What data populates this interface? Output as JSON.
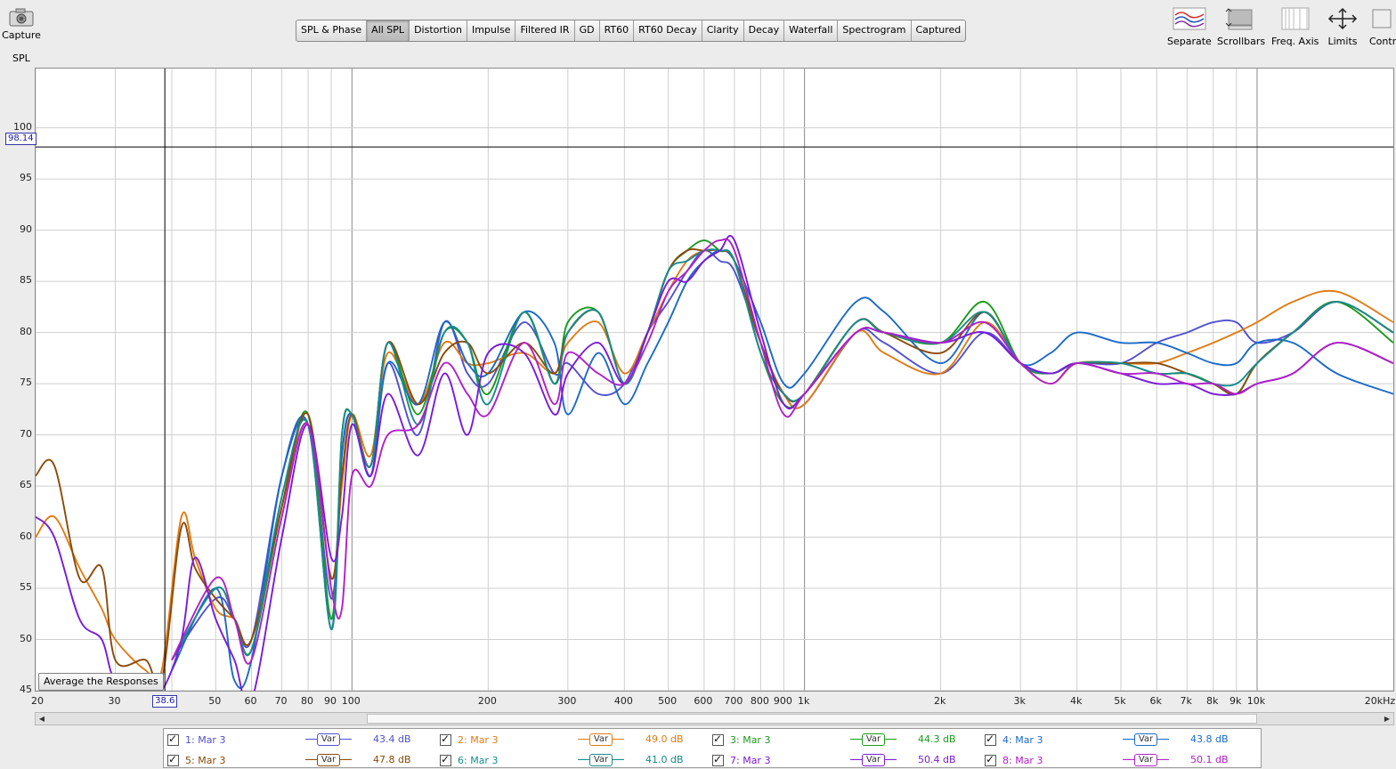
{
  "toolbar": {
    "capture_label": "Capture",
    "tabs": [
      "SPL & Phase",
      "All SPL",
      "Distortion",
      "Impulse",
      "Filtered IR",
      "GD",
      "RT60",
      "RT60 Decay",
      "Clarity",
      "Decay",
      "Waterfall",
      "Spectrogram",
      "Captured"
    ],
    "active_tab": "All SPL",
    "right_tools": [
      {
        "label": "Separate",
        "icon": "separate-icon"
      },
      {
        "label": "Scrollbars",
        "icon": "scrollbars-icon"
      },
      {
        "label": "Freq. Axis",
        "icon": "freq-axis-icon"
      },
      {
        "label": "Limits",
        "icon": "limits-icon"
      },
      {
        "label": "Controls",
        "icon": "controls-icon"
      }
    ]
  },
  "plot": {
    "y_title": "SPL",
    "cursor_y_value": "98.14",
    "cursor_x_value": "38.6",
    "average_button": "Average the Responses"
  },
  "chart_data": {
    "type": "line",
    "ylabel": "SPL",
    "ylim": [
      45,
      105.8
    ],
    "xlim": [
      20,
      20000
    ],
    "x_scale": "log",
    "y_ticks": [
      "100",
      "95",
      "90",
      "85",
      "80",
      "75",
      "70",
      "65",
      "60",
      "55",
      "50",
      "45"
    ],
    "x_ticks": [
      "20",
      "30",
      "38.6",
      "50",
      "60",
      "70",
      "80",
      "90",
      "100",
      "200",
      "300",
      "400",
      "500",
      "600",
      "700",
      "800",
      "900",
      "1k",
      "2k",
      "3k",
      "4k",
      "5k",
      "6k",
      "7k",
      "8k",
      "9k",
      "10k",
      "20kHz"
    ],
    "grid": true,
    "cursor": {
      "x": 38.6,
      "y": 98.14
    },
    "series": [
      {
        "name": "1: Mar 3",
        "color": "#5050d0",
        "x": [
          40,
          50,
          55,
          60,
          70,
          80,
          90,
          95,
          100,
          110,
          120,
          140,
          160,
          180,
          200,
          240,
          280,
          300,
          350,
          400,
          450,
          500,
          550,
          600,
          650,
          700,
          800,
          900,
          1000,
          1300,
          1500,
          2000,
          2500,
          3000,
          3500,
          4000,
          5000,
          6000,
          7000,
          8000,
          9000,
          10000,
          12000,
          15000,
          20000
        ],
        "y": [
          48,
          54,
          52,
          50,
          66,
          71,
          54,
          68,
          72,
          66,
          77,
          70,
          81,
          76,
          75,
          81,
          76,
          77,
          74,
          75,
          80,
          83,
          86,
          88,
          87,
          86,
          79,
          74,
          73,
          80,
          79,
          76,
          80,
          77,
          76,
          77,
          77,
          79,
          80,
          81,
          81,
          79,
          80,
          83,
          80
        ]
      },
      {
        "name": "2: Mar 3",
        "color": "#e07b12",
        "x": [
          20,
          22,
          25,
          28,
          30,
          35,
          38,
          42,
          45,
          50,
          55,
          60,
          70,
          80,
          90,
          95,
          100,
          110,
          120,
          140,
          160,
          180,
          200,
          240,
          280,
          300,
          350,
          400,
          450,
          500,
          550,
          600,
          650,
          700,
          800,
          900,
          1000,
          1300,
          1500,
          2000,
          2500,
          3000,
          3500,
          4000,
          5000,
          6000,
          7000,
          8000,
          9000,
          10000,
          12000,
          15000,
          20000
        ],
        "y": [
          60,
          62,
          57,
          53,
          50,
          47,
          47,
          62,
          58,
          53,
          52,
          50,
          63,
          71,
          56,
          65,
          72,
          68,
          78,
          73,
          79,
          77,
          77,
          78,
          76,
          79,
          81,
          76,
          80,
          84,
          87,
          88,
          88,
          87,
          79,
          74,
          73,
          80,
          78,
          76,
          81,
          77,
          75,
          77,
          77,
          77,
          78,
          79,
          80,
          81,
          83,
          84,
          81
        ]
      },
      {
        "name": "3: Mar 3",
        "color": "#1a9a1a",
        "x": [
          40,
          50,
          55,
          60,
          70,
          80,
          90,
          95,
          100,
          110,
          120,
          140,
          160,
          180,
          200,
          240,
          280,
          300,
          350,
          400,
          450,
          500,
          550,
          600,
          650,
          700,
          800,
          900,
          1000,
          1300,
          1500,
          2000,
          2500,
          3000,
          3500,
          4000,
          5000,
          6000,
          7000,
          8000,
          9000,
          10000,
          12000,
          15000,
          20000
        ],
        "y": [
          48,
          55,
          52,
          49,
          63,
          72,
          52,
          70,
          72,
          67,
          79,
          72,
          80,
          79,
          74,
          82,
          75,
          81,
          82,
          75,
          80,
          86,
          88,
          89,
          88,
          87,
          78,
          73,
          74,
          81,
          80,
          79,
          83,
          77,
          76,
          77,
          77,
          76,
          76,
          75,
          74,
          77,
          80,
          83,
          79
        ]
      },
      {
        "name": "4: Mar 3",
        "color": "#1a6ac8",
        "x": [
          40,
          50,
          55,
          60,
          70,
          80,
          90,
          95,
          100,
          110,
          120,
          140,
          160,
          180,
          200,
          240,
          280,
          300,
          350,
          400,
          450,
          500,
          550,
          600,
          650,
          700,
          800,
          900,
          1000,
          1300,
          1500,
          2000,
          2500,
          3000,
          3500,
          4000,
          5000,
          6000,
          7000,
          8000,
          9000,
          10000,
          12000,
          15000,
          20000
        ],
        "y": [
          47,
          55,
          46,
          48,
          66,
          71,
          51,
          68,
          72,
          66,
          77,
          73,
          81,
          77,
          76,
          82,
          79,
          72,
          78,
          73,
          77,
          81,
          85,
          87,
          88,
          87,
          81,
          75,
          76,
          83,
          82,
          77,
          82,
          77,
          78,
          80,
          79,
          79,
          78,
          77,
          77,
          79,
          79,
          76,
          74
        ]
      },
      {
        "name": "5: Mar 3",
        "color": "#8b4a0a",
        "x": [
          20,
          22,
          25,
          28,
          30,
          35,
          38,
          42,
          45,
          50,
          55,
          60,
          70,
          80,
          90,
          95,
          100,
          110,
          120,
          140,
          160,
          180,
          200,
          240,
          280,
          300,
          350,
          400,
          450,
          500,
          550,
          600,
          650,
          700,
          800,
          900,
          1000,
          1300,
          1500,
          2000,
          2500,
          3000,
          3500,
          4000,
          5000,
          6000,
          7000,
          8000,
          9000,
          10000,
          12000,
          15000,
          20000
        ],
        "y": [
          66,
          67,
          56,
          57,
          48,
          48,
          46,
          61,
          57,
          54,
          52,
          50,
          63,
          72,
          56,
          66,
          72,
          67,
          79,
          73,
          78,
          79,
          76,
          79,
          76,
          80,
          82,
          75,
          80,
          86,
          88,
          88,
          88,
          87,
          79,
          74,
          74,
          81,
          80,
          78,
          82,
          77,
          76,
          77,
          77,
          77,
          76,
          75,
          74,
          77,
          80,
          83,
          80
        ]
      },
      {
        "name": "6: Mar 3",
        "color": "#168c8c",
        "x": [
          40,
          50,
          55,
          60,
          70,
          80,
          90,
          95,
          100,
          110,
          120,
          140,
          160,
          180,
          200,
          240,
          280,
          300,
          350,
          400,
          450,
          500,
          550,
          600,
          650,
          700,
          800,
          900,
          1000,
          1300,
          1500,
          2000,
          2500,
          3000,
          3500,
          4000,
          5000,
          6000,
          7000,
          8000,
          9000,
          10000,
          12000,
          15000,
          20000
        ],
        "y": [
          48,
          55,
          52,
          49,
          64,
          71,
          51,
          70,
          72,
          67,
          79,
          71,
          80,
          79,
          73,
          82,
          75,
          80,
          82,
          75,
          80,
          86,
          87,
          88,
          88,
          87,
          78,
          74,
          74,
          81,
          80,
          79,
          82,
          77,
          76,
          77,
          77,
          76,
          76,
          75,
          75,
          77,
          80,
          83,
          80
        ]
      },
      {
        "name": "7: Mar 3",
        "color": "#7a1ad8",
        "x": [
          20,
          22,
          25,
          28,
          30,
          35,
          38,
          42,
          45,
          50,
          55,
          60,
          70,
          80,
          90,
          95,
          100,
          110,
          120,
          140,
          160,
          180,
          200,
          240,
          280,
          300,
          350,
          400,
          450,
          500,
          550,
          600,
          650,
          700,
          800,
          900,
          1000,
          1300,
          1500,
          2000,
          2500,
          3000,
          3500,
          4000,
          5000,
          6000,
          7000,
          8000,
          9000,
          10000,
          12000,
          15000,
          20000
        ],
        "y": [
          62,
          60,
          52,
          50,
          46,
          45,
          45,
          50,
          58,
          52,
          48,
          44,
          60,
          71,
          58,
          62,
          71,
          66,
          74,
          68,
          76,
          70,
          78,
          78,
          72,
          76,
          79,
          75,
          80,
          85,
          85,
          87,
          88,
          89,
          80,
          73,
          74,
          80,
          80,
          79,
          80,
          77,
          76,
          77,
          76,
          75,
          75,
          74,
          74,
          75,
          76,
          79,
          77
        ]
      },
      {
        "name": "8: Mar 3",
        "color": "#b020c8",
        "x": [
          40,
          50,
          55,
          60,
          70,
          80,
          90,
          95,
          100,
          110,
          120,
          140,
          160,
          180,
          200,
          240,
          280,
          300,
          350,
          400,
          450,
          500,
          550,
          600,
          650,
          700,
          800,
          900,
          1000,
          1300,
          1500,
          2000,
          2500,
          3000,
          3500,
          4000,
          5000,
          6000,
          7000,
          8000,
          9000,
          10000,
          12000,
          15000,
          20000
        ],
        "y": [
          48,
          56,
          52,
          48,
          62,
          71,
          55,
          53,
          66,
          65,
          70,
          71,
          77,
          74,
          72,
          79,
          73,
          78,
          76,
          75,
          79,
          84,
          86,
          88,
          89,
          88,
          79,
          72,
          74,
          80,
          80,
          79,
          81,
          77,
          75,
          77,
          76,
          76,
          75,
          75,
          74,
          75,
          76,
          79,
          77
        ]
      }
    ]
  },
  "legend": [
    {
      "name": "1: Mar 3",
      "var": "Var",
      "db": "43.4 dB",
      "color": "#5050d0"
    },
    {
      "name": "2: Mar 3",
      "var": "Var",
      "db": "49.0 dB",
      "color": "#e07b12"
    },
    {
      "name": "3: Mar 3",
      "var": "Var",
      "db": "44.3 dB",
      "color": "#1a9a1a"
    },
    {
      "name": "4: Mar 3",
      "var": "Var",
      "db": "43.8 dB",
      "color": "#1a6ac8"
    },
    {
      "name": "5: Mar 3",
      "var": "Var",
      "db": "47.8 dB",
      "color": "#8b4a0a"
    },
    {
      "name": "6: Mar 3",
      "var": "Var",
      "db": "41.0 dB",
      "color": "#168c8c"
    },
    {
      "name": "7: Mar 3",
      "var": "Var",
      "db": "50.4 dB",
      "color": "#7a1ad8"
    },
    {
      "name": "8: Mar 3",
      "var": "Var",
      "db": "50.1 dB",
      "color": "#b020c8"
    }
  ]
}
